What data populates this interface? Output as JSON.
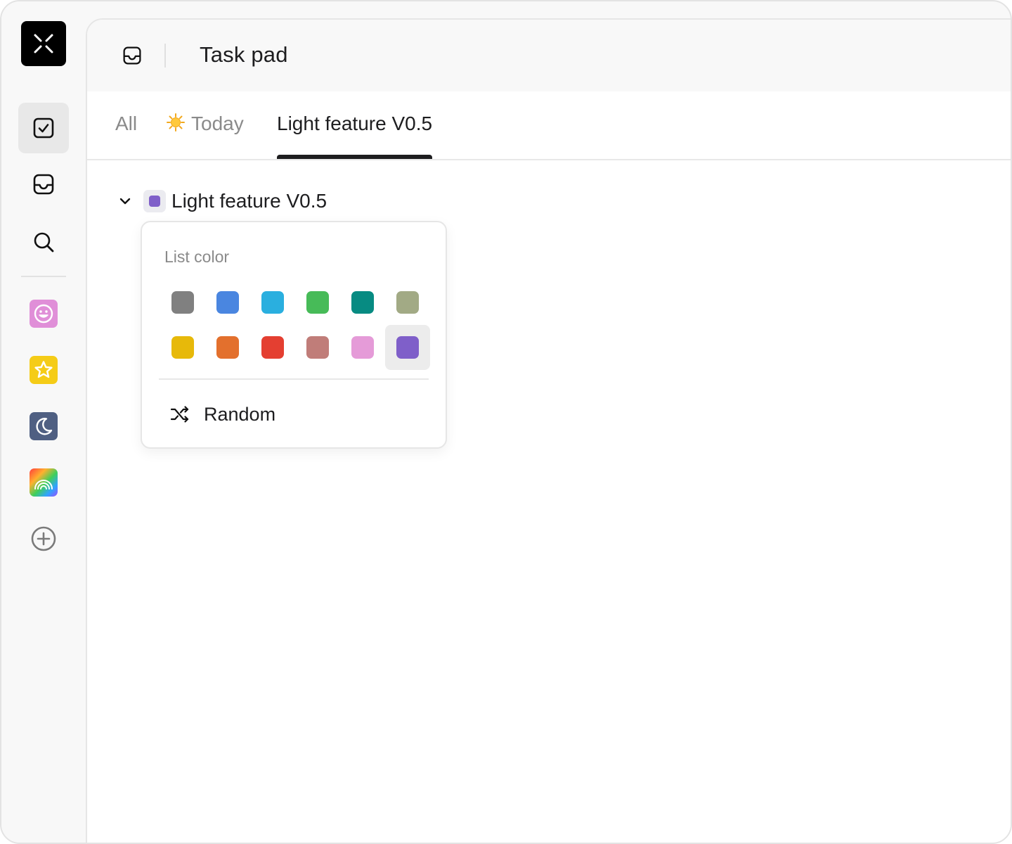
{
  "app": {
    "title": "Task pad"
  },
  "sidebar": {
    "logo": "logo-x-icon",
    "nav": [
      {
        "name": "tasks",
        "icon": "checkbox-icon",
        "active": true
      },
      {
        "name": "inbox",
        "icon": "inbox-tray-icon",
        "active": false
      },
      {
        "name": "search",
        "icon": "search-icon",
        "active": false
      }
    ],
    "lists": [
      {
        "icon": "smiley-icon",
        "color": "#e08fd8"
      },
      {
        "icon": "star-icon",
        "color": "#f5cc17"
      },
      {
        "icon": "moon-icon",
        "color": "#4f5f82"
      },
      {
        "icon": "rainbow-icon",
        "color": "gradient"
      }
    ],
    "add": "plus-circle-icon"
  },
  "tabs": [
    {
      "label": "All",
      "active": false
    },
    {
      "label": "Today",
      "icon": "sun-icon",
      "active": false
    },
    {
      "label": "Light feature V0.5",
      "active": true
    }
  ],
  "list_header": {
    "name": "Light feature V0.5",
    "color": "#7f5fc9"
  },
  "color_popover": {
    "label": "List color",
    "selected_index": 11,
    "colors": [
      "#808080",
      "#4a86e0",
      "#2aafdf",
      "#47bb58",
      "#078b82",
      "#a2aa85",
      "#e7b90a",
      "#e3702d",
      "#e43f31",
      "#c07d79",
      "#e59bd8",
      "#7f5fc9"
    ],
    "random_label": "Random"
  }
}
